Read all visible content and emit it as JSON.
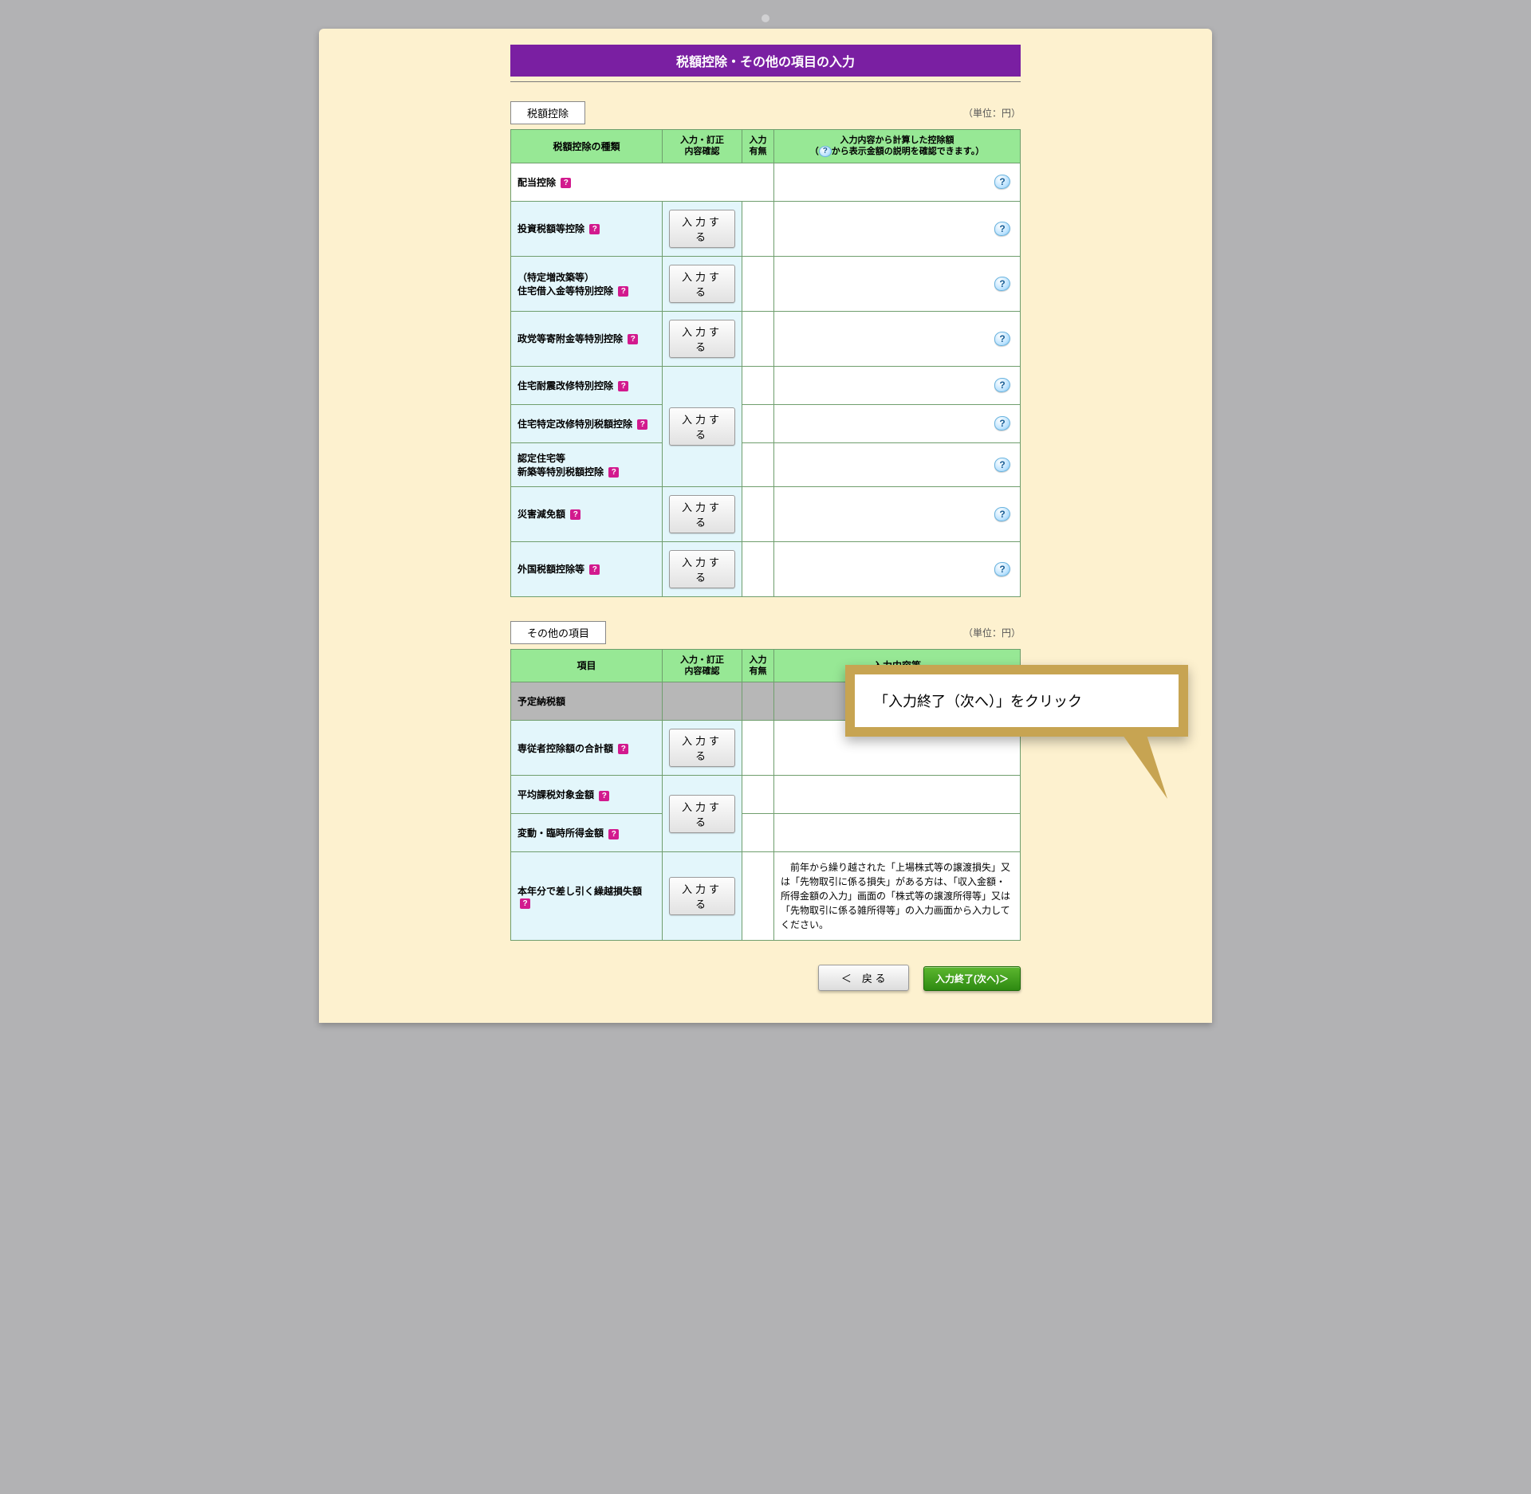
{
  "title": "税額控除・その他の項目の入力",
  "unit_label": "（単位：円）",
  "section1": {
    "label": "税額控除",
    "headers": {
      "type": "税額控除の種類",
      "input_confirm_l1": "入力・訂正",
      "input_confirm_l2": "内容確認",
      "status_l1": "入力",
      "status_l2": "有無",
      "calc_l1": "入力内容から計算した控除額",
      "calc_l2a": "（",
      "calc_l2b": "から表示金額の説明を確認できます。）"
    },
    "btn_input": "入力する",
    "rows": {
      "dividend": "配当控除",
      "invest": "投資税額等控除",
      "housing_l1": "（特定増改築等）",
      "housing_l2": "住宅借入金等特別控除",
      "party": "政党等寄附金等特別控除",
      "quake": "住宅耐震改修特別控除",
      "specific": "住宅特定改修特別税額控除",
      "certified_l1": "認定住宅等",
      "certified_l2": "新築等特別税額控除",
      "disaster": "災害減免額",
      "foreign": "外国税額控除等"
    }
  },
  "section2": {
    "label": "その他の項目",
    "headers": {
      "item": "項目",
      "input_confirm_l1": "入力・訂正",
      "input_confirm_l2": "内容確認",
      "status_l1": "入力",
      "status_l2": "有無",
      "content": "入力内容等"
    },
    "rows": {
      "scheduled": "予定納税額",
      "dependent_total": "専従者控除額の合計額",
      "average": "平均課税対象金額",
      "fluctuation": "変動・臨時所得金額",
      "carryforward": "本年分で差し引く繰越損失額"
    },
    "note": "　前年から繰り越された「上場株式等の譲渡損失」又は「先物取引に係る損失」がある方は、「収入金額・所得金額の入力」画面の「株式等の譲渡所得等」又は「先物取引に係る雑所得等」の入力画面から入力してください。"
  },
  "buttons": {
    "back": "＜　戻 る",
    "next": "入力終了(次へ)＞"
  },
  "callout": "「入力終了（次へ）」をクリック",
  "help_glyph": "?",
  "info_glyph": "?"
}
